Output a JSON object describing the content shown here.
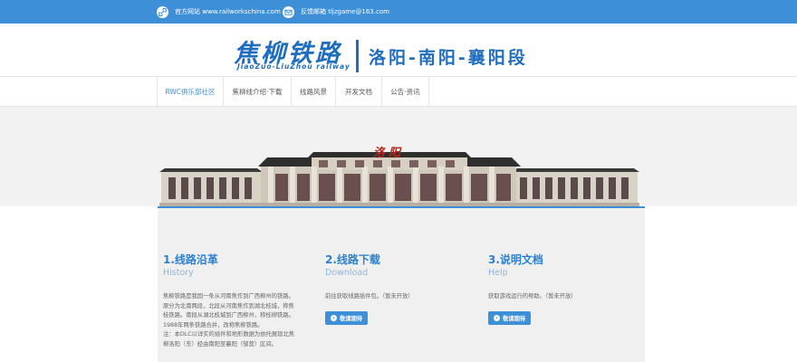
{
  "topbar": {
    "website_label": "官方网站 www.railworkschina.com",
    "feedback_label": "反馈邮箱 tljzgame@163.com",
    "website_icon": "link-icon",
    "feedback_icon": "mail-icon"
  },
  "header": {
    "logo_title": "焦柳铁路",
    "logo_subtitle": "JiaoZuo-LiuZhou railway",
    "section": "洛阳-南阳-襄阳段"
  },
  "nav": {
    "items": [
      {
        "label": "RWC俱乐部社区",
        "active": true
      },
      {
        "label": "焦柳线介绍·下载",
        "active": false
      },
      {
        "label": "线路风景",
        "active": false
      },
      {
        "label": "开发文档",
        "active": false
      },
      {
        "label": "公告·资讯",
        "active": false
      }
    ]
  },
  "banner": {
    "station_sign": "洛阳"
  },
  "columns": [
    {
      "title": "1.线路沿革",
      "subtitle": "History",
      "desc": "焦柳铁路是我国一条从河南焦作到广西柳州的铁路。原分为北南两段，北段从河南焦作到湖北枝城，称焦枝铁路。南段从湖北枝城到广西柳州，称枝柳铁路。1988年两条铁路合并，改称焦柳铁路。",
      "note": "注：本DLC以详实的插件和地形数据为依托展现北焦柳洛阳（东）经由南阳至襄阳（邹营）区间。",
      "button": null
    },
    {
      "title": "2.线路下载",
      "subtitle": "Download",
      "desc": "前往获取线路插件包。（暂未开放）",
      "note": "",
      "button": "敬请期待"
    },
    {
      "title": "3.说明文档",
      "subtitle": "Help",
      "desc": "获取游戏运行的帮助。（暂未开放）",
      "note": "",
      "button": "敬请期待"
    }
  ],
  "colors": {
    "accent": "#3d8fd8",
    "logo_blue": "#1f6dbf",
    "content_bg": "#f0f0f0"
  }
}
